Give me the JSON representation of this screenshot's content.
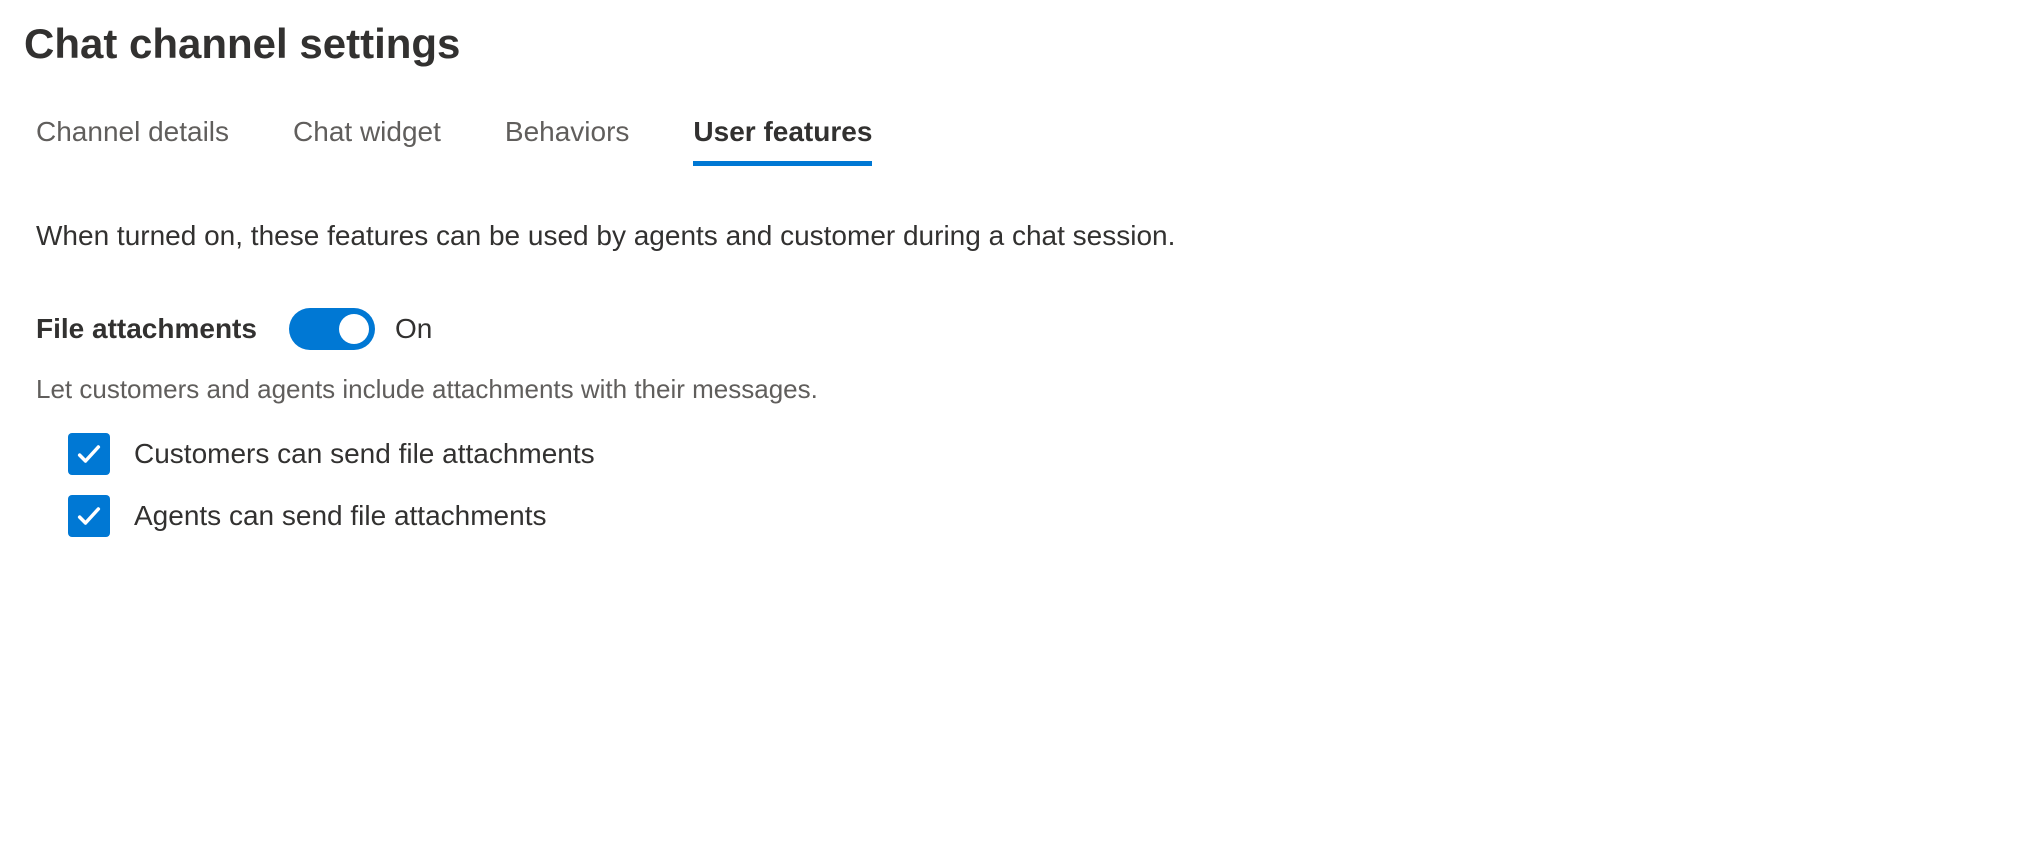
{
  "title": "Chat channel settings",
  "tabs": [
    {
      "label": "Channel details",
      "active": false
    },
    {
      "label": "Chat widget",
      "active": false
    },
    {
      "label": "Behaviors",
      "active": false
    },
    {
      "label": "User features",
      "active": true
    }
  ],
  "description": "When turned on, these features can be used by agents and customer during a chat session.",
  "fileAttachments": {
    "label": "File attachments",
    "toggle": {
      "on": true,
      "stateLabel": "On"
    },
    "help": "Let customers and agents include attachments with their messages.",
    "options": [
      {
        "label": "Customers can send file attachments",
        "checked": true
      },
      {
        "label": "Agents can send file attachments",
        "checked": true
      }
    ]
  },
  "colors": {
    "accent": "#0078d4"
  }
}
